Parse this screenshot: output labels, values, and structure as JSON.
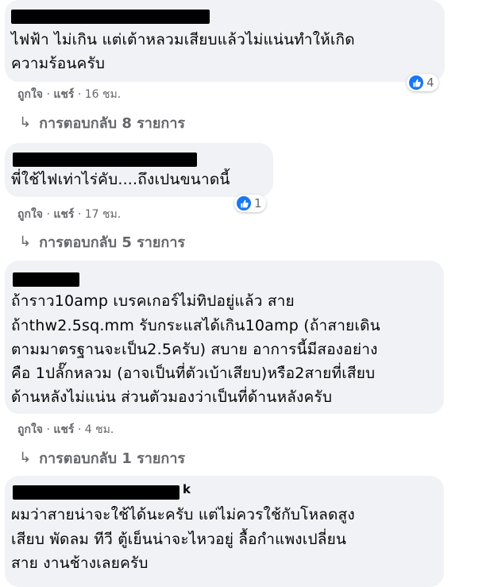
{
  "comments": [
    {
      "text_lines": [
        "ไฟฟ้า ไม่เกิน แต่เต้าหลวมเสียบแล้วไม่แน่นทำให้เกิด",
        "ความร้อนครับ"
      ],
      "like": "ถูกใจ",
      "share": "แชร์",
      "time": "16 ชม.",
      "reactions": "4",
      "replies": "การตอบกลับ 8 รายการ"
    },
    {
      "text_lines": [
        "พี่ใช้ไฟเท่าไร่คับ....ถึงเปนขนาดนี้"
      ],
      "like": "ถูกใจ",
      "share": "แชร์",
      "time": "17 ชม.",
      "reactions": "1",
      "replies": "การตอบกลับ 5 รายการ"
    },
    {
      "text_lines": [
        "ถ้าราว10amp เบรคเกอร์ไม่ทิปอยู่แล้ว สาย",
        "ถ้าthw2.5sq.mm รับกระแสได้เกิน10amp (ถ้าสายเดิน",
        "ตามมาตรฐานจะเป็น2.5ครับ) สบาย อาการนี้มีสองอย่าง",
        "คือ 1ปลั๊กหลวม (อาจเป็นที่ตัวเบ้าเสียบ)หรือ2สายที่เสียบ",
        "ด้านหลังไม่แน่น ส่วนตัวมองว่าเป็นที่ด้านหลังครับ"
      ],
      "like": "ถูกใจ",
      "share": "แชร์",
      "time": "4 ชม.",
      "replies": "การตอบกลับ 1 รายการ"
    },
    {
      "author_tail": "k",
      "text_lines": [
        "ผมว่าสายน่าจะใช้ได้นะครับ แต่ไม่ควรใช้กับโหลดสูง",
        "เสียบ พัดลม ทีวี ตู้เย็นน่าจะไหวอยู่ ลื้อกำแพงเปลี่ยน",
        "สาย งานช้างเลยครับ"
      ]
    }
  ],
  "separator": " · ",
  "reply_arrow": "↳",
  "colors": {
    "bubble": "#f0f2f5",
    "meta": "#65676b",
    "like_blue": "#1877f2"
  }
}
